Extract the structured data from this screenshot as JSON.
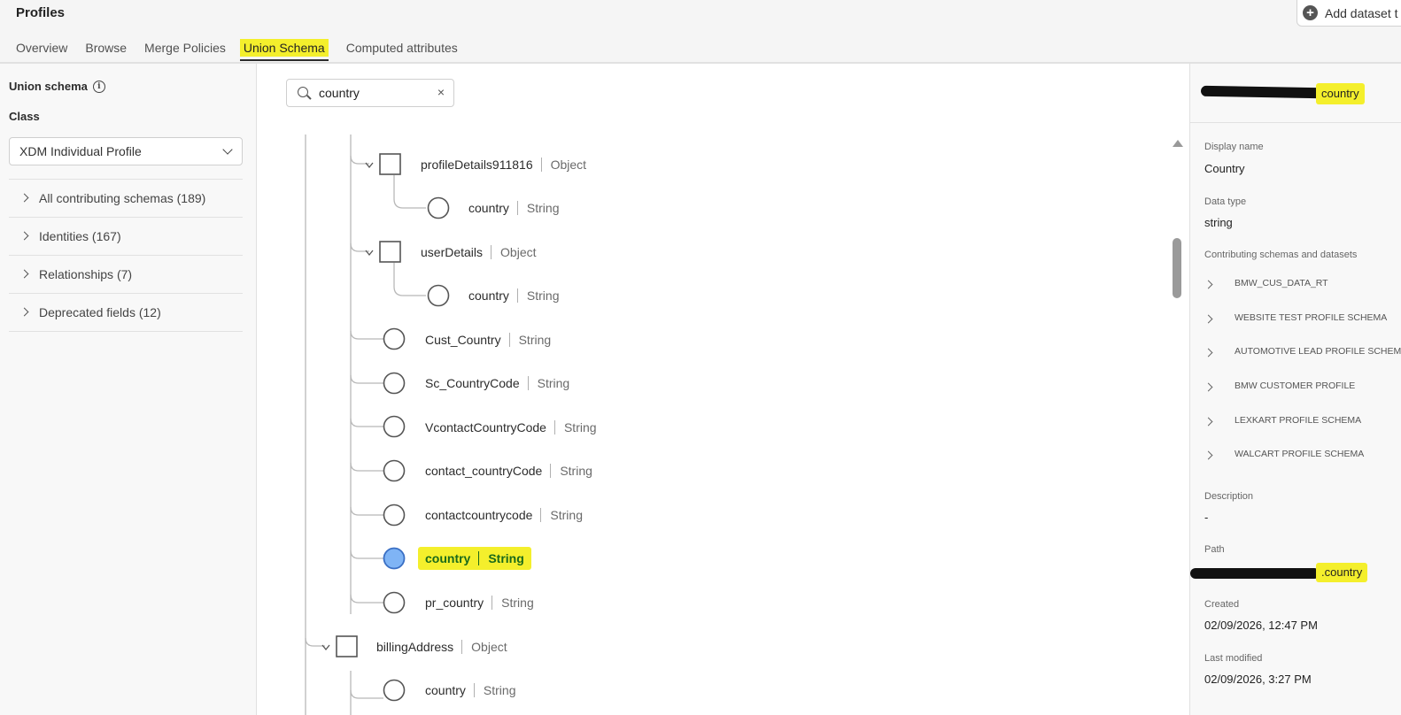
{
  "header": {
    "title": "Profiles",
    "add_dataset_label": "Add dataset t",
    "tabs": [
      {
        "label": "Overview"
      },
      {
        "label": "Browse"
      },
      {
        "label": "Merge Policies"
      },
      {
        "label": "Union Schema"
      },
      {
        "label": "Computed attributes"
      }
    ]
  },
  "sidebar": {
    "title": "Union schema",
    "class_label": "Class",
    "class_value": "XDM Individual Profile",
    "accordions": [
      {
        "label": "All contributing schemas (189)"
      },
      {
        "label": "Identities (167)"
      },
      {
        "label": "Relationships (7)"
      },
      {
        "label": "Deprecated fields (12)"
      }
    ]
  },
  "search": {
    "value": "country",
    "clear": "×"
  },
  "tree": {
    "nodes": [
      {
        "name": "profileDetails911816",
        "type": "Object"
      },
      {
        "name": "country",
        "type": "String"
      },
      {
        "name": "userDetails",
        "type": "Object"
      },
      {
        "name": "country",
        "type": "String"
      },
      {
        "name": "Cust_Country",
        "type": "String"
      },
      {
        "name": "Sc_CountryCode",
        "type": "String"
      },
      {
        "name": "VcontactCountryCode",
        "type": "String"
      },
      {
        "name": "contact_countryCode",
        "type": "String"
      },
      {
        "name": "contactcountrycode",
        "type": "String"
      },
      {
        "name": "country",
        "type": "String",
        "selected": true
      },
      {
        "name": "pr_country",
        "type": "String"
      },
      {
        "name": "billingAddress",
        "type": "Object"
      },
      {
        "name": "country",
        "type": "String"
      }
    ]
  },
  "details": {
    "field_suffix": "country",
    "display_name_label": "Display name",
    "display_name": "Country",
    "data_type_label": "Data type",
    "data_type": "string",
    "contributing_label": "Contributing schemas and datasets",
    "datasets": [
      {
        "label": "BMW_CUS_DATA_RT"
      },
      {
        "label": "WEBSITE TEST PROFILE SCHEMA"
      },
      {
        "label": "AUTOMOTIVE LEAD PROFILE SCHEMA"
      },
      {
        "label": "BMW CUSTOMER PROFILE"
      },
      {
        "label": "LEXKART PROFILE SCHEMA"
      },
      {
        "label": "WALCART PROFILE SCHEMA"
      }
    ],
    "description_label": "Description",
    "description": "-",
    "path_label": "Path",
    "path_suffix": ".country",
    "created_label": "Created",
    "created": "02/09/2026, 12:47 PM",
    "modified_label": "Last modified",
    "modified": "02/09/2026, 3:27 PM"
  },
  "colors": {
    "highlight": "#f4ef2c",
    "selected_node": "#7fb4f5",
    "selected_text": "#1a6a1a"
  }
}
